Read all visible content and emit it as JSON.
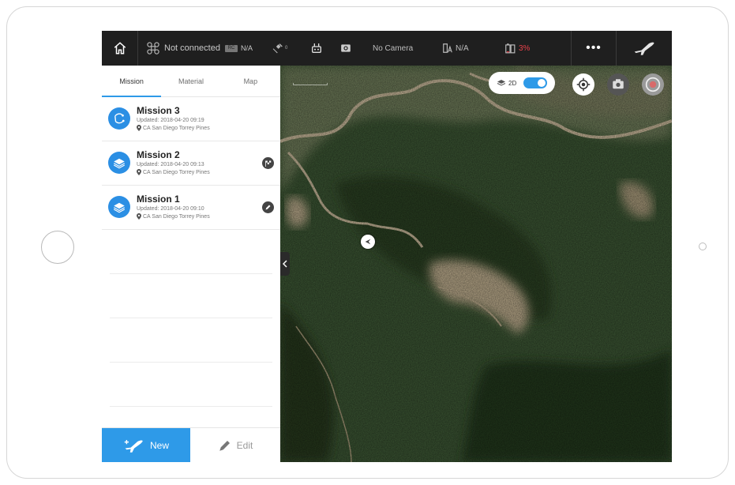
{
  "topbar": {
    "connection_status": "Not connected",
    "rc_label": "N/A",
    "rc_badge": "RC",
    "satellite_count": "0",
    "camera_status": "No Camera",
    "hd_label": "N/A",
    "battery_label": "3%",
    "more_label": "•••"
  },
  "tabs": [
    "Mission",
    "Material",
    "Map"
  ],
  "missions": [
    {
      "title": "Mission 3",
      "updated": "Updated: 2018-04-20 09:19",
      "location": "CA San Diego Torrey Pines",
      "icon": "waypoint-mission-icon"
    },
    {
      "title": "Mission 2",
      "updated": "Updated: 2018-04-20 09:13",
      "location": "CA San Diego Torrey Pines",
      "icon": "mapping-mission-icon",
      "badge": "checkered-flag-icon"
    },
    {
      "title": "Mission 1",
      "updated": "Updated: 2018-04-20 09:10",
      "location": "CA San Diego Torrey Pines",
      "icon": "mapping-mission-icon",
      "badge": "edit-pencil-icon"
    }
  ],
  "buttons": {
    "new_label": "New",
    "edit_label": "Edit"
  },
  "map": {
    "view_mode": "2D",
    "toggle_on": true
  },
  "colors": {
    "accent": "#2e9ae8",
    "battery_warning": "#e8414a",
    "topbar": "#1f1f1f"
  }
}
